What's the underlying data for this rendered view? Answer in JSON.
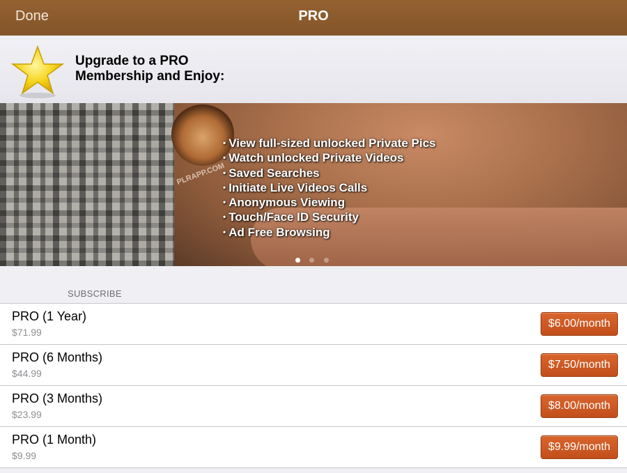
{
  "nav": {
    "done_label": "Done",
    "title": "PRO"
  },
  "promo": {
    "icon": "star-icon",
    "headline_line1": "Upgrade to a PRO",
    "headline_line2": "Membership and Enjoy:"
  },
  "banner": {
    "features": [
      "View full-sized unlocked Private Pics",
      "Watch unlocked Private Videos",
      "Saved Searches",
      "Initiate Live Videos Calls",
      "Anonymous Viewing",
      "Touch/Face ID Security",
      "Ad Free Browsing"
    ],
    "bullet": "•",
    "watermark_text": "PLRAPP.COM",
    "page_dots": {
      "count": 3,
      "active_index": 0
    }
  },
  "subscribe": {
    "section_label": "SUBSCRIBE",
    "plans": [
      {
        "name": "PRO (1 Year)",
        "price": "$71.99",
        "button": "$6.00/month"
      },
      {
        "name": "PRO (6 Months)",
        "price": "$44.99",
        "button": "$7.50/month"
      },
      {
        "name": "PRO (3 Months)",
        "price": "$23.99",
        "button": "$8.00/month"
      },
      {
        "name": "PRO (1 Month)",
        "price": "$9.99",
        "button": "$9.99/month"
      }
    ]
  },
  "colors": {
    "nav_bar": "#8b5a2b",
    "buy_button": "#cc5a22",
    "background": "#efeff4"
  }
}
